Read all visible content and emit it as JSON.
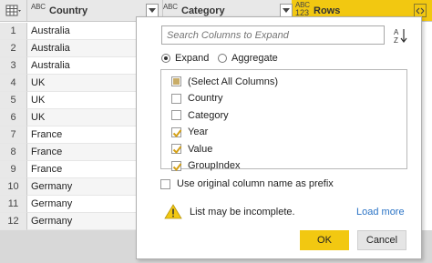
{
  "header": {
    "country_type": "ABC",
    "country_label": "Country",
    "category_type": "ABC",
    "category_label": "Category",
    "rows_type_top": "ABC",
    "rows_type_bottom": "123",
    "rows_label": "Rows"
  },
  "rows": [
    {
      "num": "1",
      "country": "Australia"
    },
    {
      "num": "2",
      "country": "Australia"
    },
    {
      "num": "3",
      "country": "Australia"
    },
    {
      "num": "4",
      "country": "UK"
    },
    {
      "num": "5",
      "country": "UK"
    },
    {
      "num": "6",
      "country": "UK"
    },
    {
      "num": "7",
      "country": "France"
    },
    {
      "num": "8",
      "country": "France"
    },
    {
      "num": "9",
      "country": "France"
    },
    {
      "num": "10",
      "country": "Germany"
    },
    {
      "num": "11",
      "country": "Germany"
    },
    {
      "num": "12",
      "country": "Germany"
    }
  ],
  "popup": {
    "search_placeholder": "Search Columns to Expand",
    "expand_label": "Expand",
    "aggregate_label": "Aggregate",
    "columns": [
      {
        "label": "(Select All Columns)",
        "state": "partial"
      },
      {
        "label": "Country",
        "state": "unchecked"
      },
      {
        "label": "Category",
        "state": "unchecked"
      },
      {
        "label": "Year",
        "state": "checked"
      },
      {
        "label": "Value",
        "state": "checked"
      },
      {
        "label": "GroupIndex",
        "state": "checked"
      }
    ],
    "prefix_label": "Use original column name as prefix",
    "warning_text": "List may be incomplete.",
    "load_more": "Load more",
    "ok_label": "OK",
    "cancel_label": "Cancel"
  },
  "colors": {
    "accent": "#f2c811",
    "link": "#2a73c5",
    "check": "#d4a017"
  }
}
